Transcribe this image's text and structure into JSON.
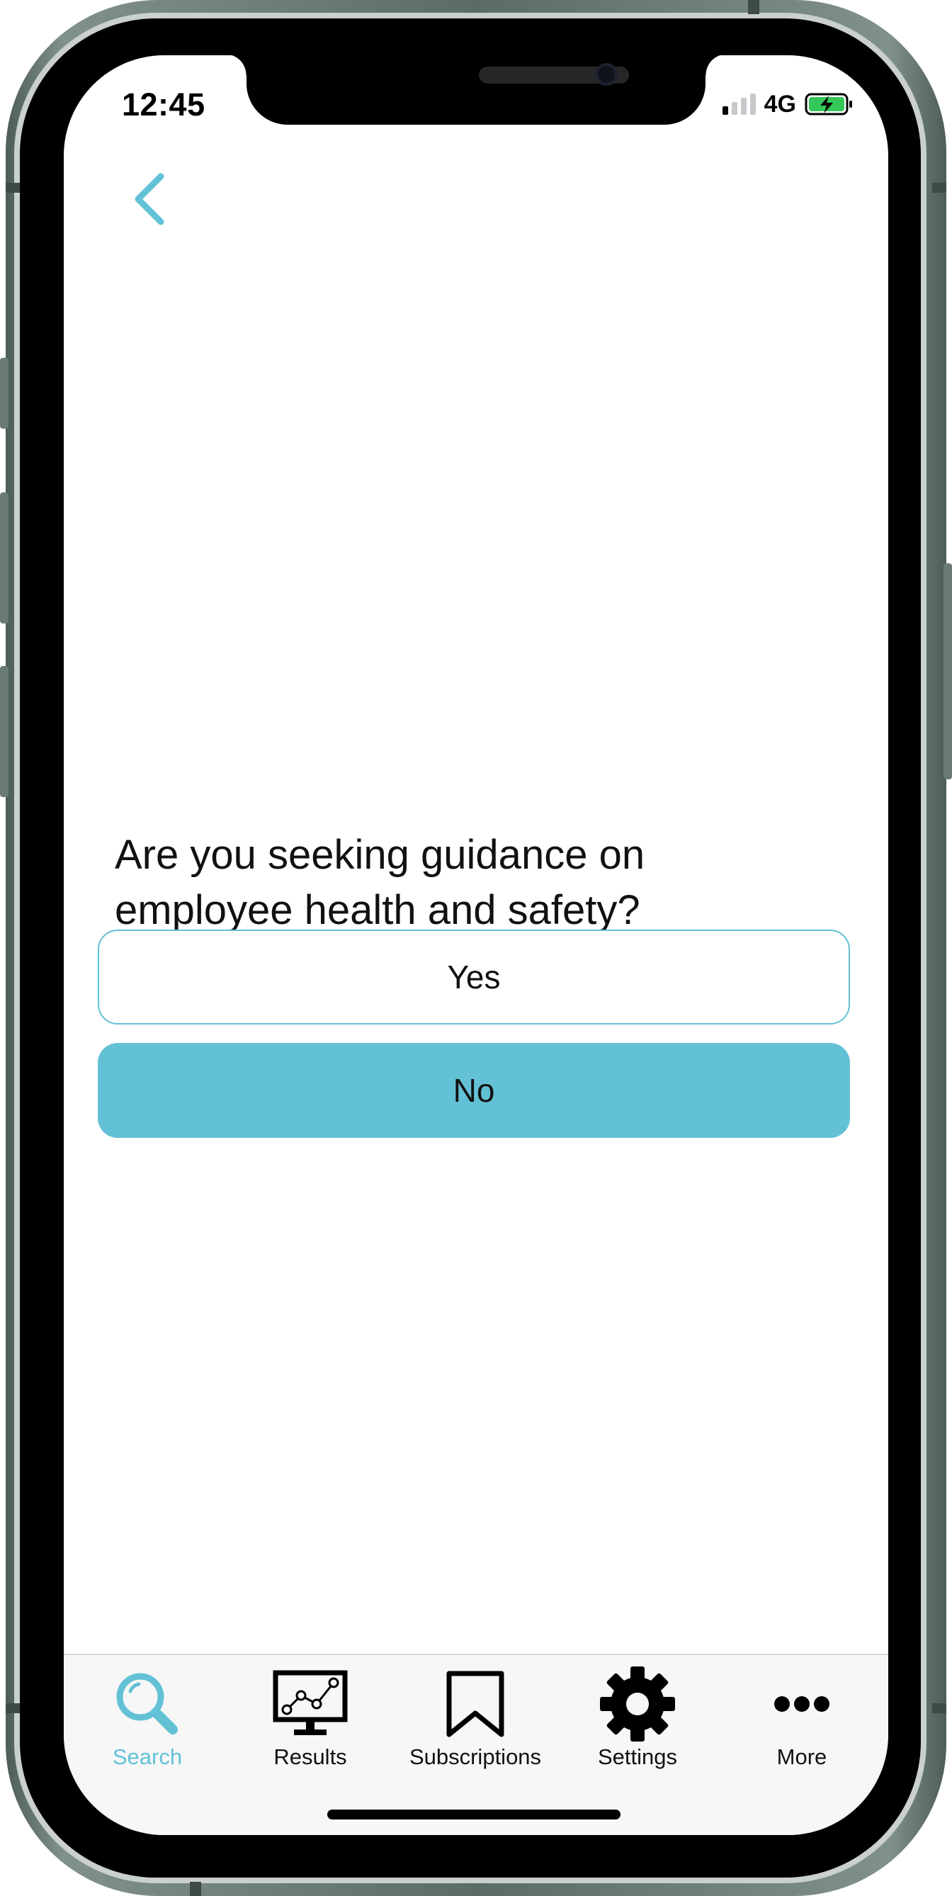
{
  "status_bar": {
    "time": "12:45",
    "network": "4G",
    "signal_bars_active": 1,
    "battery_state": "charging",
    "battery_color": "#34c759"
  },
  "nav": {
    "back_icon": "chevron-left-icon"
  },
  "question": {
    "text": "Are you seeking guidance on employee health and safety?"
  },
  "answers": [
    {
      "label": "Yes",
      "style": "outlined"
    },
    {
      "label": "No",
      "style": "filled"
    }
  ],
  "tab_bar": {
    "active_tab": "Search",
    "items": [
      {
        "label": "Search",
        "icon": "search-icon"
      },
      {
        "label": "Results",
        "icon": "results-chart-icon"
      },
      {
        "label": "Subscriptions",
        "icon": "bookmark-icon"
      },
      {
        "label": "Settings",
        "icon": "gear-icon"
      },
      {
        "label": "More",
        "icon": "more-dots-icon"
      }
    ]
  },
  "colors": {
    "accent": "#63c1d6",
    "text": "#111111",
    "background": "#ffffff",
    "tab_bar_background": "#f7f7f7",
    "device_frame": "#5b6c65"
  }
}
